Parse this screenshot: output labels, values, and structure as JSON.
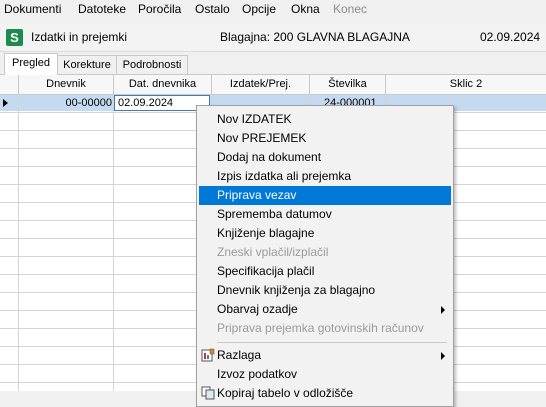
{
  "menubar": {
    "items": [
      {
        "label": "Dokumenti",
        "disabled": false
      },
      {
        "label": "Datoteke",
        "disabled": false
      },
      {
        "label": "Poročila",
        "disabled": false
      },
      {
        "label": "Ostalo",
        "disabled": false
      },
      {
        "label": "Opcije",
        "disabled": false
      },
      {
        "label": "Okna",
        "disabled": false
      },
      {
        "label": "Konec",
        "disabled": true
      }
    ]
  },
  "window": {
    "title": "Izdatki in prejemki",
    "cashbox": "Blagajna: 200  GLAVNA BLAGAJNA",
    "date": "02.09.2024",
    "app_icon": "S"
  },
  "tabs": [
    {
      "label": "Pregled",
      "active": true
    },
    {
      "label": "Korekture",
      "active": false
    },
    {
      "label": "Podrobnosti",
      "active": false
    }
  ],
  "grid": {
    "columns": [
      "Dnevnik",
      "Dat. dnevnika",
      "Izdatek/Prej.",
      "Številka",
      "Sklic 2"
    ],
    "rows": [
      {
        "dnevnik": "00-00000",
        "datum": "02.09.2024",
        "izdatek": "",
        "stevilka": "24-000001",
        "sklic": ""
      }
    ]
  },
  "context_menu": {
    "items": [
      {
        "label": "Nov IZDATEK"
      },
      {
        "label": "Nov PREJEMEK"
      },
      {
        "label": "Dodaj na dokument"
      },
      {
        "label": "Izpis izdatka ali prejemka"
      },
      {
        "label": "Priprava vezav",
        "highlighted": true
      },
      {
        "label": "Sprememba datumov"
      },
      {
        "label": "Knjiženje blagajne"
      },
      {
        "label": "Zneski vplačil/izplačil",
        "disabled": true
      },
      {
        "label": "Specifikacija plačil"
      },
      {
        "label": "Dnevnik knjiženja za blagajno"
      },
      {
        "label": "Obarvaj ozadje",
        "submenu": true
      },
      {
        "label": "Priprava prejemka gotovinskih računov",
        "disabled": true
      },
      {
        "label": "Razlaga",
        "submenu": true,
        "icon": "report-icon"
      },
      {
        "label": "Izvoz podatkov"
      },
      {
        "label": "Kopiraj tabelo v odložišče",
        "icon": "copy-icon"
      }
    ]
  },
  "colors": {
    "selection": "#0078d7",
    "row_highlight": "#c5d9f1",
    "app_icon": "#1e8a4e"
  }
}
